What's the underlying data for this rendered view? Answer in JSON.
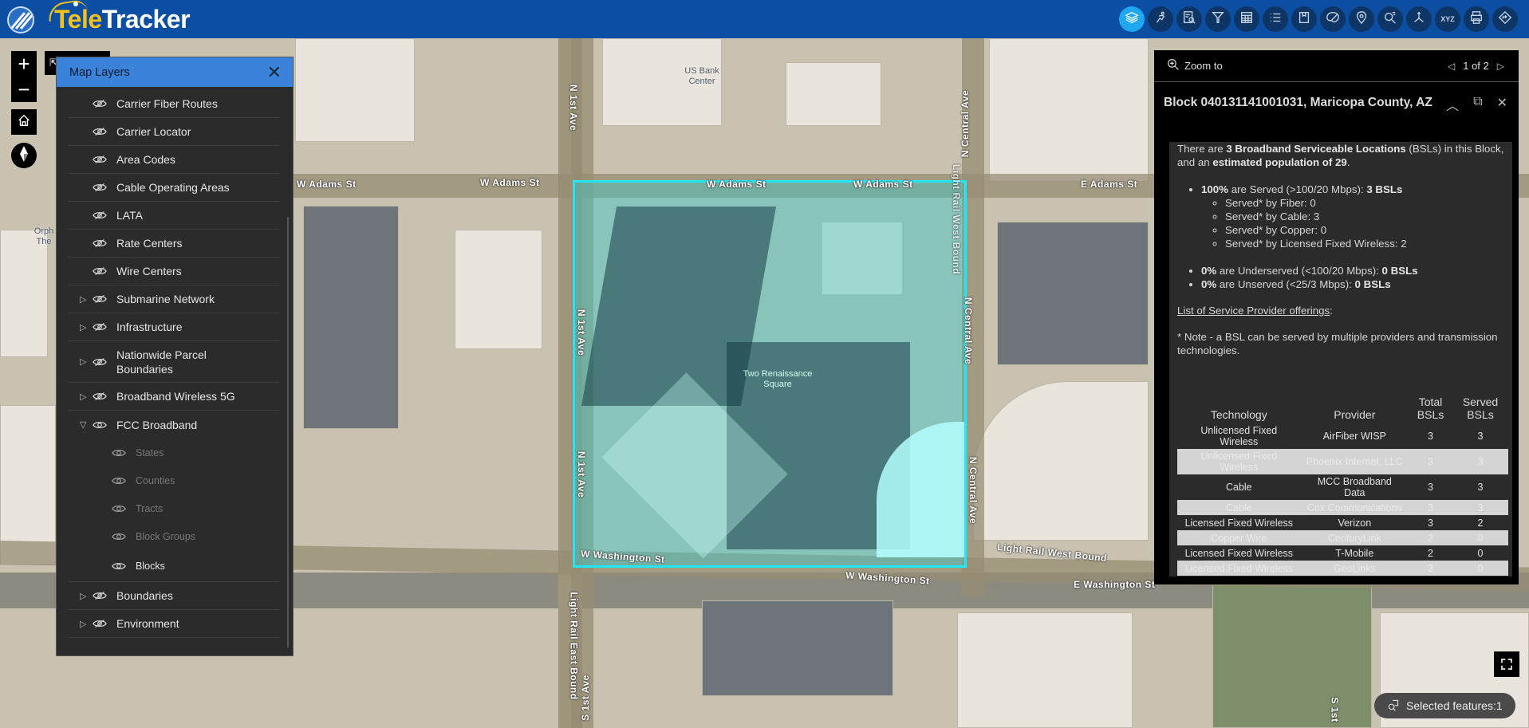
{
  "app": {
    "title_part1": "Tele",
    "title_part2": "Tracker"
  },
  "toolbar": {
    "items": [
      {
        "name": "layers",
        "icon": "layers-icon",
        "active": true
      },
      {
        "name": "locate-carrier",
        "icon": "runner-icon"
      },
      {
        "name": "query",
        "icon": "document-search-icon"
      },
      {
        "name": "filter",
        "icon": "filter-icon"
      },
      {
        "name": "attribute-table",
        "icon": "table-icon"
      },
      {
        "name": "legend",
        "icon": "list-icon"
      },
      {
        "name": "bookmarks",
        "icon": "bookmark-icon"
      },
      {
        "name": "basemap",
        "icon": "palette-icon"
      },
      {
        "name": "location",
        "icon": "map-pin-icon"
      },
      {
        "name": "search",
        "icon": "search-icon"
      },
      {
        "name": "measure",
        "icon": "axes-icon"
      },
      {
        "name": "coordinates",
        "icon": "xyz-icon",
        "glyph": "XYZ"
      },
      {
        "name": "print",
        "icon": "print-icon"
      },
      {
        "name": "directions",
        "icon": "directions-icon"
      }
    ]
  },
  "map_controls": {
    "zoom_in": "+",
    "zoom_out": "−"
  },
  "map_labels": {
    "streets": [
      "W Adams St",
      "W Adams St",
      "W Adams St",
      "W Adams St",
      "E Adams St",
      "N 1st Ave",
      "N 1st Ave",
      "N 1st Ave",
      "N Central Ave",
      "N Central Ave",
      "N Central Ave",
      "Light Rail West Bound",
      "Light Rail West Bound",
      "W Washington St",
      "W Washington St",
      "E Washington St",
      "Light Rail East Bound",
      "S 1st Ave",
      "S 1st"
    ],
    "pois": [
      "US Bank Center",
      "Two Renaissance Square",
      "Orph The"
    ]
  },
  "layers_panel": {
    "title": "Map Layers",
    "layers": [
      {
        "label": "Carrier Fiber Routes",
        "expandable": false,
        "visible": false
      },
      {
        "label": "Carrier Locator",
        "expandable": false,
        "visible": false
      },
      {
        "label": "Area Codes",
        "expandable": false,
        "visible": false
      },
      {
        "label": "Cable Operating Areas",
        "expandable": false,
        "visible": false
      },
      {
        "label": "LATA",
        "expandable": false,
        "visible": false
      },
      {
        "label": "Rate Centers",
        "expandable": false,
        "visible": false
      },
      {
        "label": "Wire Centers",
        "expandable": false,
        "visible": false
      },
      {
        "label": "Submarine Network",
        "expandable": true,
        "visible": false
      },
      {
        "label": "Infrastructure",
        "expandable": true,
        "visible": false
      },
      {
        "label": "Nationwide Parcel Boundaries",
        "expandable": true,
        "visible": false
      },
      {
        "label": "Broadband Wireless 5G",
        "expandable": true,
        "visible": false
      },
      {
        "label": "FCC Broadband",
        "expandable": true,
        "expanded": true,
        "visible": true,
        "sublayers": [
          {
            "label": "States",
            "active": false
          },
          {
            "label": "Counties",
            "active": false
          },
          {
            "label": "Tracts",
            "active": false
          },
          {
            "label": "Block Groups",
            "active": false
          },
          {
            "label": "Blocks",
            "active": true
          }
        ]
      },
      {
        "label": "Boundaries",
        "expandable": true,
        "visible": false
      },
      {
        "label": "Environment",
        "expandable": true,
        "visible": false
      }
    ]
  },
  "popup": {
    "zoom_to": "Zoom to",
    "pager": "1 of 2",
    "title": "Block 040131141001031, Maricopa County, AZ",
    "intro": {
      "p1": "There are ",
      "bsl_count_label": "3 Broadband Serviceable Locations",
      "p2": " (BSLs) in this Block, and an ",
      "population_label": "estimated population of 29",
      "p3": "."
    },
    "served": {
      "pct": "100%",
      "text": " are Served (>100/20 Mbps): ",
      "count": "3 BSLs",
      "breakdown": [
        "Served* by Fiber: 0",
        "Served* by Cable: 3",
        "Served* by Copper: 0",
        "Served* by Licensed Fixed Wireless: 2"
      ]
    },
    "underserved": {
      "pct": "0%",
      "text": " are Underserved (<100/20 Mbps): ",
      "count": "0 BSLs"
    },
    "unserved": {
      "pct": "0%",
      "text": " are Unserved (<25/3 Mbps): ",
      "count": "0 BSLs"
    },
    "offerings_link": "List of Service Provider offerings",
    "offerings_colon": ":",
    "note": "* Note - a BSL can be served by multiple providers and transmission technologies.",
    "table": {
      "headers": [
        "Technology",
        "Provider",
        "Total BSLs",
        "Served BSLs"
      ],
      "rows": [
        {
          "technology": "Unlicensed Fixed Wireless",
          "provider": "AirFiber WISP",
          "total": "3",
          "served": "3"
        },
        {
          "technology": "Unlicensed Fixed Wireless",
          "provider": "Phoenix Internet, LLC",
          "total": "3",
          "served": "3"
        },
        {
          "technology": "Cable",
          "provider": "MCC Broadband Data",
          "total": "3",
          "served": "3"
        },
        {
          "technology": "Cable",
          "provider": "Cox Communications",
          "total": "3",
          "served": "3"
        },
        {
          "technology": "Licensed Fixed Wireless",
          "provider": "Verizon",
          "total": "3",
          "served": "2"
        },
        {
          "technology": "Copper Wire",
          "provider": "CenturyLink",
          "total": "2",
          "served": "0"
        },
        {
          "technology": "Licensed Fixed Wireless",
          "provider": "T-Mobile",
          "total": "2",
          "served": "0"
        },
        {
          "technology": "Licensed Fixed Wireless",
          "provider": "GeoLinks",
          "total": "3",
          "served": "0"
        }
      ]
    }
  },
  "status": {
    "selected_features": "Selected features:1"
  },
  "colors": {
    "header_bg": "#0b4ea2",
    "accent": "#1fa7f0",
    "logo_yellow": "#f6c11b",
    "selection_outline": "#22e6f5",
    "panel_header": "#3b82db"
  }
}
